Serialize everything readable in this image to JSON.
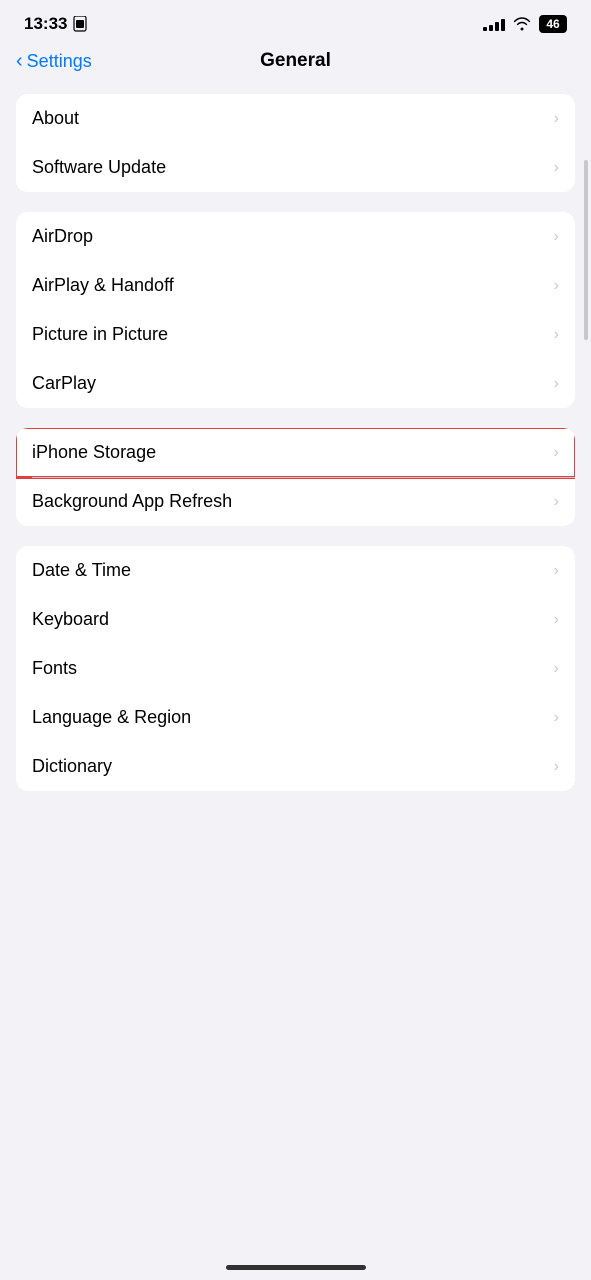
{
  "statusBar": {
    "time": "13:33",
    "batteryLabel": "46"
  },
  "header": {
    "backLabel": "Settings",
    "title": "General"
  },
  "groups": [
    {
      "id": "group1",
      "items": [
        {
          "id": "about",
          "label": "About",
          "highlighted": false
        },
        {
          "id": "software-update",
          "label": "Software Update",
          "highlighted": false
        }
      ]
    },
    {
      "id": "group2",
      "items": [
        {
          "id": "airdrop",
          "label": "AirDrop",
          "highlighted": false
        },
        {
          "id": "airplay-handoff",
          "label": "AirPlay & Handoff",
          "highlighted": false
        },
        {
          "id": "picture-in-picture",
          "label": "Picture in Picture",
          "highlighted": false
        },
        {
          "id": "carplay",
          "label": "CarPlay",
          "highlighted": false
        }
      ]
    },
    {
      "id": "group3",
      "items": [
        {
          "id": "iphone-storage",
          "label": "iPhone Storage",
          "highlighted": true
        },
        {
          "id": "background-app-refresh",
          "label": "Background App Refresh",
          "highlighted": false
        }
      ]
    },
    {
      "id": "group4",
      "items": [
        {
          "id": "date-time",
          "label": "Date & Time",
          "highlighted": false
        },
        {
          "id": "keyboard",
          "label": "Keyboard",
          "highlighted": false
        },
        {
          "id": "fonts",
          "label": "Fonts",
          "highlighted": false
        },
        {
          "id": "language-region",
          "label": "Language & Region",
          "highlighted": false
        },
        {
          "id": "dictionary",
          "label": "Dictionary",
          "highlighted": false
        }
      ]
    }
  ]
}
